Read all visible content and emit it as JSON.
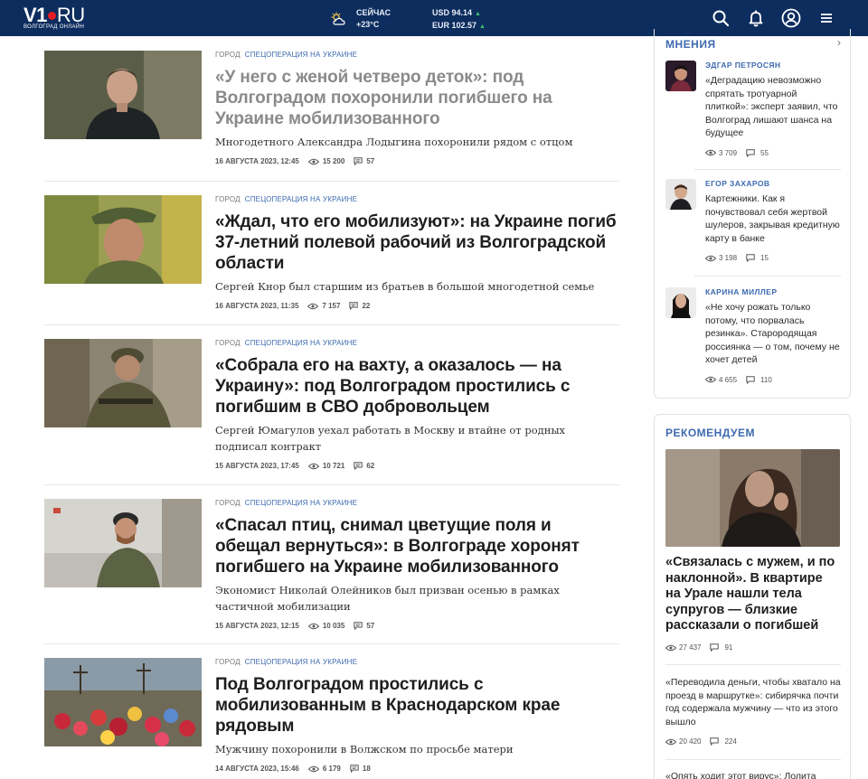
{
  "header": {
    "logo_main": "V1",
    "logo_ru": "RU",
    "logo_sub": "ВОЛГОГРАД ОНЛАЙН",
    "weather_label": "СЕЙЧАС",
    "weather_temp": "+23°C",
    "usd": "USD 94.14",
    "eur": "EUR 102.57",
    "icons": [
      "search-icon",
      "bell-icon",
      "user-icon",
      "menu-icon"
    ]
  },
  "news": [
    {
      "tag1": "ГОРОД",
      "tag2": "СПЕЦОПЕРАЦИЯ НА УКРАИНЕ",
      "title": "«У него с женой четверо деток»: под Волгоградом похоронили погибшего на Украине мобилизованного",
      "lead": "Многодетного Александра Лодыгина похоронили рядом с отцом",
      "date": "16 АВГУСТА 2023, 12:45",
      "views": "15 200",
      "comments": "57"
    },
    {
      "tag1": "ГОРОД",
      "tag2": "СПЕЦОПЕРАЦИЯ НА УКРАИНЕ",
      "title": "«Ждал, что его мобилизуют»: на Украине погиб 37-летний полевой рабочий из Волгоградской области",
      "lead": "Сергей Кнор был старшим из братьев в большой многодетной семье",
      "date": "16 АВГУСТА 2023, 11:35",
      "views": "7 157",
      "comments": "22"
    },
    {
      "tag1": "ГОРОД",
      "tag2": "СПЕЦОПЕРАЦИЯ НА УКРАИНЕ",
      "title": "«Собрала его на вахту, а оказалось — на Украину»: под Волгоградом простились с погибшим в СВО добровольцем",
      "lead": "Сергей Юмагулов уехал работать в Москву и втайне от родных подписал контракт",
      "date": "15 АВГУСТА 2023, 17:45",
      "views": "10 721",
      "comments": "62"
    },
    {
      "tag1": "ГОРОД",
      "tag2": "СПЕЦОПЕРАЦИЯ НА УКРАИНЕ",
      "title": "«Спасал птиц, снимал цветущие поля и обещал вернуться»: в Волгограде хоронят погибшего на Украине мобилизованного",
      "lead": "Экономист Николай Олейников был призван осенью в рамках частичной мобилизации",
      "date": "15 АВГУСТА 2023, 12:15",
      "views": "10 035",
      "comments": "57"
    },
    {
      "tag1": "ГОРОД",
      "tag2": "СПЕЦОПЕРАЦИЯ НА УКРАИНЕ",
      "title": "Под Волгоградом простились с мобилизованным в Краснодарском крае рядовым",
      "lead": "Мужчину похоронили в Волжском по просьбе матери",
      "date": "14 АВГУСТА 2023, 15:46",
      "views": "6 179",
      "comments": "18"
    }
  ],
  "opinions": {
    "title": "МНЕНИЯ",
    "items": [
      {
        "name": "ЭДГАР ПЕТРОСЯН",
        "quote": "«Деградацию невозможно спрятать тротуарной плиткой»: эксперт заявил, что Волгоград лишают шанса на будущее",
        "views": "3 709",
        "comments": "55"
      },
      {
        "name": "ЕГОР ЗАХАРОВ",
        "quote": "Картежники. Как я почувствовал себя жертвой шулеров, закрывая кредитную карту в банке",
        "views": "3 198",
        "comments": "15"
      },
      {
        "name": "КАРИНА МИЛЛЕР",
        "quote": "«Не хочу рожать только потому, что порвалась резинка». Старородящая россиянка — о том, почему не хочет детей",
        "views": "4 655",
        "comments": "110"
      }
    ]
  },
  "recommend": {
    "title": "РЕКОМЕНДУЕМ",
    "main_title": "«Связалась с мужем, и по наклонной». В квартире на Урале нашли тела супругов — близкие рассказали о погибшей",
    "main_views": "27 437",
    "main_comments": "91",
    "second_title": "«Переводила деньги, чтобы хватало на проезд в маршрутке»: сибирячка почти год содержала мужчину — что из этого вышло",
    "second_views": "20 420",
    "second_comments": "224",
    "third_title": "«Опять ходит этот вирус»: Лолита"
  },
  "colors": {
    "header_bg": "#0d2d5e",
    "accent_blue": "#3d6ab0",
    "logo_red": "#e31e24"
  }
}
